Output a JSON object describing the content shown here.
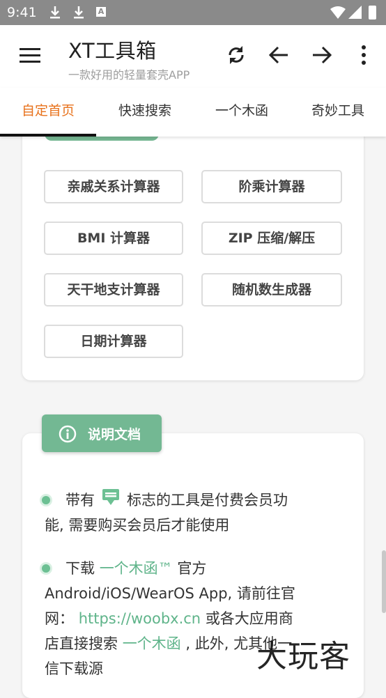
{
  "status": {
    "time": "9:41",
    "badge": "A"
  },
  "appbar": {
    "title": "XT工具箱",
    "subtitle": "一款好用的轻量套壳APP"
  },
  "tabs": [
    "自定首页",
    "快速搜索",
    "一个木函",
    "奇妙工具"
  ],
  "tools": [
    "亲戚关系计算器",
    "阶乘计算器",
    "BMI 计算器",
    "ZIP 压缩/解压",
    "天干地支计算器",
    "随机数生成器",
    "日期计算器"
  ],
  "doc": {
    "title": "说明文档",
    "p1": {
      "pre": "带有",
      "post": "标志的工具是付费会员功",
      "line2": "能, 需要购买会员后才能使用"
    },
    "p2": {
      "pre": "下载",
      "brand": "一个木函™",
      "post": "官方",
      "line2": "Android/iOS/WearOS App, 请前往官",
      "line3a": "网：",
      "url": "https://woobx.cn",
      "line3b": "或各大应用商",
      "line4a": "店直接搜索",
      "brand2": "一个木函",
      "line4b": ", 此外, 尤其他一",
      "line5": "信下载源"
    }
  },
  "watermark": "大玩客",
  "colors": {
    "accent": "#e8721c",
    "green": "#73b893",
    "statusbar": "#8a8a8a"
  }
}
